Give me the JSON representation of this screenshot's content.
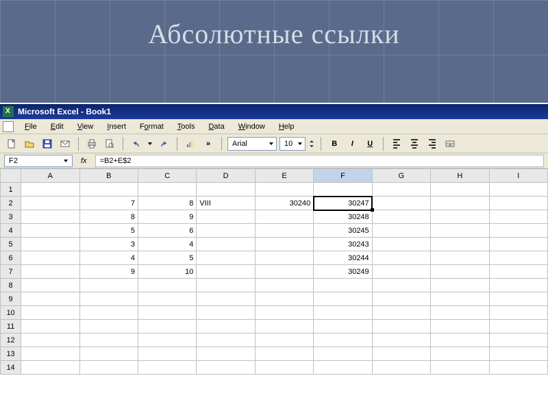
{
  "slide": {
    "title": "Абсолютные ссылки"
  },
  "titlebar": {
    "text": "Microsoft Excel - Book1"
  },
  "menu": {
    "items": [
      "File",
      "Edit",
      "View",
      "Insert",
      "Format",
      "Tools",
      "Data",
      "Window",
      "Help"
    ]
  },
  "toolbar": {
    "font": "Arial",
    "fontSize": "10",
    "bold": "B",
    "italic": "I",
    "underline": "U"
  },
  "formulaBar": {
    "cellRef": "F2",
    "fxLabel": "fx",
    "formula": "=B2+E$2"
  },
  "columns": [
    "A",
    "B",
    "C",
    "D",
    "E",
    "F",
    "G",
    "H",
    "I"
  ],
  "rows": [
    "1",
    "2",
    "3",
    "4",
    "5",
    "6",
    "7",
    "8",
    "9",
    "10",
    "11",
    "12",
    "13",
    "14"
  ],
  "chart_data": {
    "type": "table",
    "title": "Spreadsheet cells",
    "columns": [
      "B",
      "C",
      "D",
      "E",
      "F"
    ],
    "rows": [
      {
        "r": 2,
        "B": 7,
        "C": 8,
        "D": "VIII",
        "E": 30240,
        "F": 30247
      },
      {
        "r": 3,
        "B": 8,
        "C": 9,
        "D": "",
        "E": "",
        "F": 30248
      },
      {
        "r": 4,
        "B": 5,
        "C": 6,
        "D": "",
        "E": "",
        "F": 30245
      },
      {
        "r": 5,
        "B": 3,
        "C": 4,
        "D": "",
        "E": "",
        "F": 30243
      },
      {
        "r": 6,
        "B": 4,
        "C": 5,
        "D": "",
        "E": "",
        "F": 30244
      },
      {
        "r": 7,
        "B": 9,
        "C": 10,
        "D": "",
        "E": "",
        "F": 30249
      }
    ]
  }
}
